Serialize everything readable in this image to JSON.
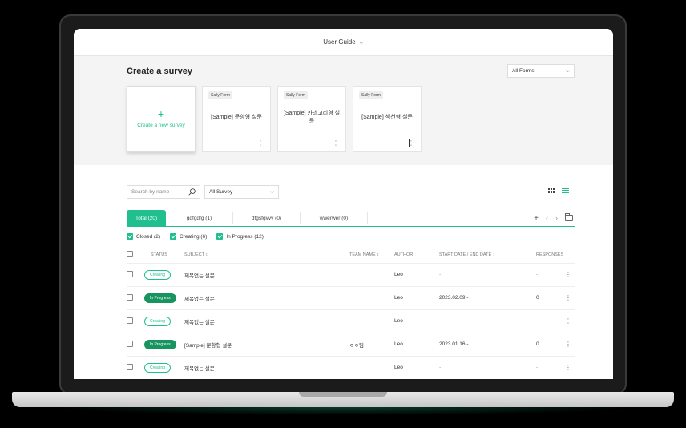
{
  "header": {
    "title": "User Guide"
  },
  "create": {
    "title": "Create a survey",
    "form_filter": "All Forms",
    "new_card": {
      "plus": "+",
      "label": "Create a new survey"
    },
    "cards": [
      {
        "tag": "Sally Form",
        "title": "[Sample] 문항형 설문"
      },
      {
        "tag": "Sally Form",
        "title": "[Sample] 카테고리형 설문"
      },
      {
        "tag": "Sally Form",
        "title": "[Sample] 섹션형 설문"
      }
    ]
  },
  "list": {
    "search_placeholder": "Search by name",
    "survey_filter": "All Survey",
    "tabs": [
      {
        "label": "Total (20)"
      },
      {
        "label": "gdfgdfg (1)"
      },
      {
        "label": "dfgsfgvvv (0)"
      },
      {
        "label": "wwerwer (0)"
      }
    ],
    "status_filters": [
      {
        "label": "Closed (2)"
      },
      {
        "label": "Creating (6)"
      },
      {
        "label": "In Progress (12)"
      }
    ],
    "columns": {
      "status": "STATUS",
      "subject": "SUBJECT ↕",
      "team": "TEAM NAME ↕",
      "author": "AUTHOR",
      "date": "START DATE / END DATE ↕",
      "responses": "RESPONSES"
    },
    "rows": [
      {
        "status": "Creating",
        "subject": "제목없는 설문",
        "team": "",
        "author": "Leo",
        "date": "-",
        "responses": "-"
      },
      {
        "status": "In Progress",
        "subject": "제목없는 설문",
        "team": "",
        "author": "Leo",
        "date": "2023.02.09 -",
        "responses": "0"
      },
      {
        "status": "Creating",
        "subject": "제목없는 설문",
        "team": "",
        "author": "Leo",
        "date": "-",
        "responses": "-"
      },
      {
        "status": "In Progress",
        "subject": "[Sample] 문항형 설문",
        "team": "ㅇㅇ팀",
        "author": "Leo",
        "date": "2023.01.16 -",
        "responses": "0"
      },
      {
        "status": "Creating",
        "subject": "제목없는 설문",
        "team": "",
        "author": "Leo",
        "date": "-",
        "responses": "-"
      }
    ]
  },
  "colors": {
    "accent": "#1fbf8f",
    "progress": "#17945f"
  }
}
